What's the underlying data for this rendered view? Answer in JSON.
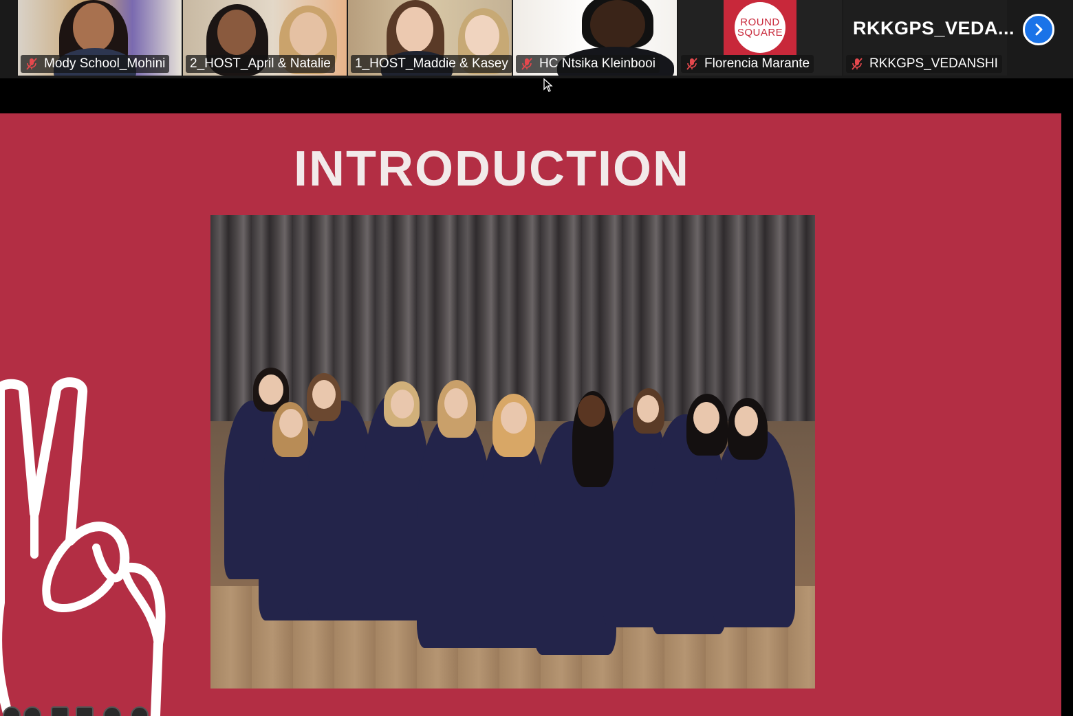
{
  "participants": [
    {
      "name": "Mody School_Mohini",
      "muted": true,
      "active": false
    },
    {
      "name": "2_HOST_April & Natalie",
      "muted": false,
      "active": true
    },
    {
      "name": "1_HOST_Maddie & Kasey",
      "muted": false,
      "active": false
    },
    {
      "name": "HC Ntsika Kleinbooi",
      "muted": true,
      "active": false
    },
    {
      "name": "Florencia Marante",
      "muted": true,
      "active": false
    },
    {
      "name": "RKKGPS_VEDANSHI",
      "muted": true,
      "active": false
    }
  ],
  "video_off_name": "RKKGPS_VEDA...",
  "logo": {
    "line1": "ROUND",
    "line2": "SQUARE"
  },
  "slide": {
    "title": "INTRODUCTION"
  },
  "colors": {
    "slide_bg": "#b32e44",
    "active_border": "#2fd37a",
    "next_button": "#1a73e8"
  },
  "icons": [
    "mic-off-icon",
    "chevron-right-icon",
    "cursor-icon",
    "peace-hand-icon"
  ]
}
